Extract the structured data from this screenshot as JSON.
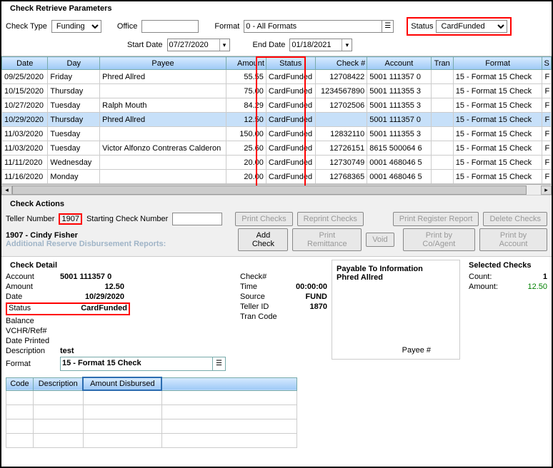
{
  "params": {
    "title": "Check Retrieve Parameters",
    "check_type_lbl": "Check Type",
    "check_type_val": "Funding",
    "office_lbl": "Office",
    "office_val": "",
    "format_lbl": "Format",
    "format_val": "0 - All Formats",
    "status_lbl": "Status",
    "status_val": "CardFunded",
    "start_lbl": "Start Date",
    "start_val": "07/27/2020",
    "end_lbl": "End Date",
    "end_val": "01/18/2021"
  },
  "grid": {
    "headers": {
      "date": "Date",
      "day": "Day",
      "payee": "Payee",
      "amount": "Amount",
      "status": "Status",
      "check": "Check #",
      "account": "Account",
      "tran": "Tran",
      "format": "Format",
      "s": "S"
    },
    "rows": [
      {
        "date": "09/25/2020",
        "day": "Friday",
        "payee": "Phred Allred",
        "amount": "55.55",
        "status": "CardFunded",
        "check": "12708422",
        "account": "5001 111357 0",
        "tran": "",
        "format": "15 - Format 15 Check",
        "sel": false,
        "s": "F"
      },
      {
        "date": "10/15/2020",
        "day": "Thursday",
        "payee": "",
        "amount": "75.00",
        "status": "CardFunded",
        "check": "1234567890",
        "account": "5001 111355 3",
        "tran": "",
        "format": "15 - Format 15 Check",
        "sel": false,
        "s": "F"
      },
      {
        "date": "10/27/2020",
        "day": "Tuesday",
        "payee": "Ralph Mouth",
        "amount": "84.29",
        "status": "CardFunded",
        "check": "12702506",
        "account": "5001 111355 3",
        "tran": "",
        "format": "15 - Format 15 Check",
        "sel": false,
        "s": "F"
      },
      {
        "date": "10/29/2020",
        "day": "Thursday",
        "payee": "Phred Allred",
        "amount": "12.50",
        "status": "CardFunded",
        "check": "",
        "account": "5001 111357 0",
        "tran": "",
        "format": "15 - Format 15 Check",
        "sel": true,
        "s": "F"
      },
      {
        "date": "11/03/2020",
        "day": "Tuesday",
        "payee": "",
        "amount": "150.00",
        "status": "CardFunded",
        "check": "12832110",
        "account": "5001 111355 3",
        "tran": "",
        "format": "15 - Format 15 Check",
        "sel": false,
        "s": "F"
      },
      {
        "date": "11/03/2020",
        "day": "Tuesday",
        "payee": "Victor Alfonzo Contreras Calderon",
        "amount": "25.60",
        "status": "CardFunded",
        "check": "12726151",
        "account": "8615 500064 6",
        "tran": "",
        "format": "15 - Format 15 Check",
        "sel": false,
        "s": "F"
      },
      {
        "date": "11/11/2020",
        "day": "Wednesday",
        "payee": "",
        "amount": "20.00",
        "status": "CardFunded",
        "check": "12730749",
        "account": "0001 468046 5",
        "tran": "",
        "format": "15 - Format 15 Check",
        "sel": false,
        "s": "F"
      },
      {
        "date": "11/16/2020",
        "day": "Monday",
        "payee": "",
        "amount": "20.00",
        "status": "CardFunded",
        "check": "12768365",
        "account": "0001 468046 5",
        "tran": "",
        "format": "15 - Format 15 Check",
        "sel": false,
        "s": "F"
      }
    ]
  },
  "actions": {
    "title": "Check Actions",
    "teller_lbl": "Teller Number",
    "teller_val": "1907",
    "starting_lbl": "Starting Check Number",
    "starting_val": "",
    "print_checks": "Print Checks",
    "reprint_checks": "Reprint Checks",
    "print_register": "Print Register Report",
    "delete_checks": "Delete Checks",
    "user_line": "1907 - Cindy Fisher",
    "reserve": "Additional Reserve Disbursement Reports:",
    "add_check": "Add Check",
    "print_remit": "Print Remittance",
    "void": "Void",
    "print_co": "Print by Co/Agent",
    "print_acct": "Print by Account"
  },
  "detail": {
    "title": "Check Detail",
    "account_l": "Account",
    "account_v": "5001 111357 0",
    "amount_l": "Amount",
    "amount_v": "12.50",
    "date_l": "Date",
    "date_v": "10/29/2020",
    "status_l": "Status",
    "status_v": "CardFunded",
    "balance_l": "Balance",
    "balance_v": "",
    "vchr_l": "VCHR/Ref#",
    "vchr_v": "",
    "datep_l": "Date Printed",
    "datep_v": "",
    "desc_l": "Description",
    "desc_v": "test",
    "fmt_l": "Format",
    "fmt_v": "15 - Format 15 Check",
    "check_l": "Check#",
    "check_v": "",
    "time_l": "Time",
    "time_v": "00:00:00",
    "source_l": "Source",
    "source_v": "FUND",
    "tellerid_l": "Teller ID",
    "tellerid_v": "1870",
    "tran_l": "Tran Code",
    "tran_v": ""
  },
  "payable": {
    "title": "Payable To Information",
    "name": "Phred Allred",
    "payee_num_l": "Payee #"
  },
  "selected": {
    "title": "Selected Checks",
    "count_l": "Count:",
    "count_v": "1",
    "amount_l": "Amount:",
    "amount_v": "12.50"
  },
  "subgrid": {
    "h1": "Code",
    "h2": "Description",
    "h3": "Amount Disbursed"
  }
}
